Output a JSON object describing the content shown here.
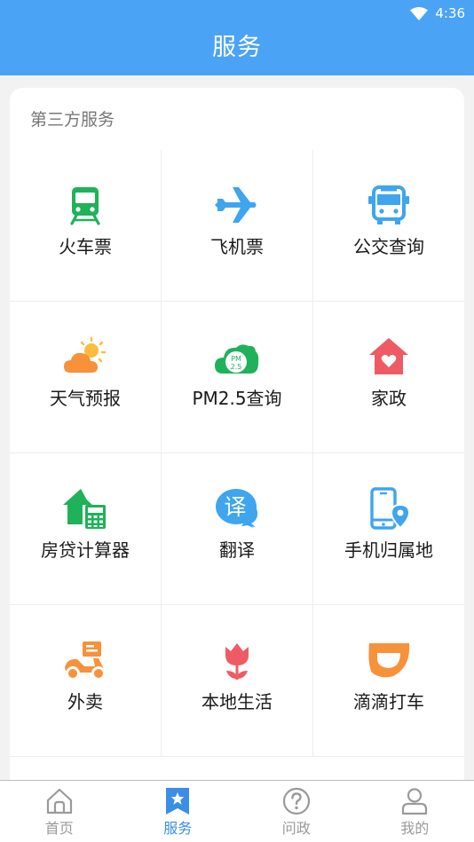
{
  "status_bar": {
    "time": "4:36"
  },
  "header": {
    "title": "服务"
  },
  "section": {
    "title": "第三方服务"
  },
  "services": [
    {
      "label": "火车票",
      "icon": "train-icon",
      "color": "#1fb25a"
    },
    {
      "label": "飞机票",
      "icon": "airplane-icon",
      "color": "#3ea5ee"
    },
    {
      "label": "公交查询",
      "icon": "bus-icon",
      "color": "#3ea5ee"
    },
    {
      "label": "天气预报",
      "icon": "weather-icon",
      "color": "#f7913a"
    },
    {
      "label": "PM2.5查询",
      "icon": "pm25-cloud-icon",
      "color": "#1fb25a",
      "icon_text": "PM 2.5"
    },
    {
      "label": "家政",
      "icon": "house-heart-icon",
      "color": "#ef5b64"
    },
    {
      "label": "房贷计算器",
      "icon": "house-calculator-icon",
      "color": "#1fb25a"
    },
    {
      "label": "翻译",
      "icon": "translate-bubble-icon",
      "color": "#3ea5ee",
      "icon_text": "译"
    },
    {
      "label": "手机归属地",
      "icon": "phone-location-icon",
      "color": "#3ea5ee"
    },
    {
      "label": "外卖",
      "icon": "delivery-scooter-icon",
      "color": "#f7913a"
    },
    {
      "label": "本地生活",
      "icon": "tulip-icon",
      "color": "#ef5b64"
    },
    {
      "label": "滴滴打车",
      "icon": "didi-icon",
      "color": "#f7913a"
    }
  ],
  "tabs": [
    {
      "label": "首页",
      "icon": "home-icon",
      "active": false
    },
    {
      "label": "服务",
      "icon": "star-bookmark-icon",
      "active": true
    },
    {
      "label": "问政",
      "icon": "question-icon",
      "active": false
    },
    {
      "label": "我的",
      "icon": "user-icon",
      "active": false
    }
  ],
  "colors": {
    "header": "#4ba3f5",
    "active_tab": "#3a8ee6",
    "inactive_tab": "#9a9a9a"
  }
}
